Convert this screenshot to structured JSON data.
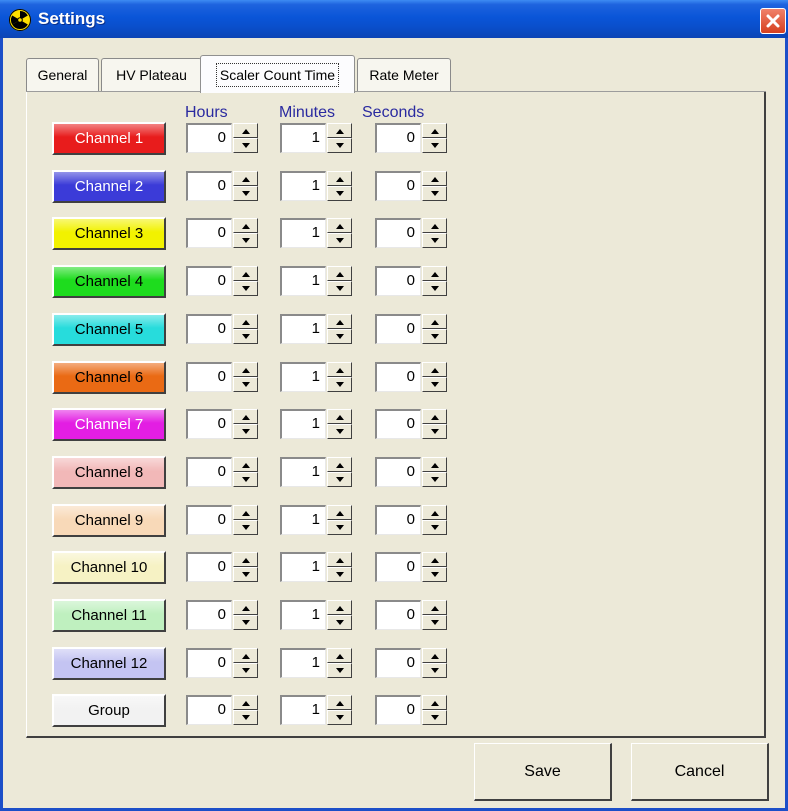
{
  "window": {
    "title": "Settings",
    "icon": "radiation-icon",
    "close_icon": "close-icon"
  },
  "tabs": [
    {
      "label": "General",
      "active": false
    },
    {
      "label": "HV Plateau",
      "active": false
    },
    {
      "label": "Scaler Count Time",
      "active": true
    },
    {
      "label": "Rate Meter",
      "active": false
    }
  ],
  "columns": {
    "hours": "Hours",
    "minutes": "Minutes",
    "seconds": "Seconds"
  },
  "channels": [
    {
      "label": "Channel 1",
      "color": "#e81c1c",
      "text_color": "#ffffff",
      "hours": "0",
      "minutes": "1",
      "seconds": "0"
    },
    {
      "label": "Channel 2",
      "color": "#3b3bd8",
      "text_color": "#ffffff",
      "hours": "0",
      "minutes": "1",
      "seconds": "0"
    },
    {
      "label": "Channel 3",
      "color": "#f2f200",
      "text_color": "#000000",
      "hours": "0",
      "minutes": "1",
      "seconds": "0"
    },
    {
      "label": "Channel 4",
      "color": "#1edc1e",
      "text_color": "#000000",
      "hours": "0",
      "minutes": "1",
      "seconds": "0"
    },
    {
      "label": "Channel 5",
      "color": "#27dcdc",
      "text_color": "#000000",
      "hours": "0",
      "minutes": "1",
      "seconds": "0"
    },
    {
      "label": "Channel 6",
      "color": "#ea6a14",
      "text_color": "#000000",
      "hours": "0",
      "minutes": "1",
      "seconds": "0"
    },
    {
      "label": "Channel 7",
      "color": "#e31ee3",
      "text_color": "#ffffff",
      "hours": "0",
      "minutes": "1",
      "seconds": "0"
    },
    {
      "label": "Channel 8",
      "color": "#f2b8b8",
      "text_color": "#000000",
      "hours": "0",
      "minutes": "1",
      "seconds": "0"
    },
    {
      "label": "Channel 9",
      "color": "#f8d9b8",
      "text_color": "#000000",
      "hours": "0",
      "minutes": "1",
      "seconds": "0"
    },
    {
      "label": "Channel 10",
      "color": "#f6f2c4",
      "text_color": "#000000",
      "hours": "0",
      "minutes": "1",
      "seconds": "0"
    },
    {
      "label": "Channel 11",
      "color": "#bff0bf",
      "text_color": "#000000",
      "hours": "0",
      "minutes": "1",
      "seconds": "0"
    },
    {
      "label": "Channel 12",
      "color": "#c4c4f2",
      "text_color": "#000000",
      "hours": "0",
      "minutes": "1",
      "seconds": "0"
    },
    {
      "label": "Group",
      "color": "#f2f2f2",
      "text_color": "#000000",
      "hours": "0",
      "minutes": "1",
      "seconds": "0"
    }
  ],
  "buttons": {
    "save": "Save",
    "cancel": "Cancel"
  }
}
